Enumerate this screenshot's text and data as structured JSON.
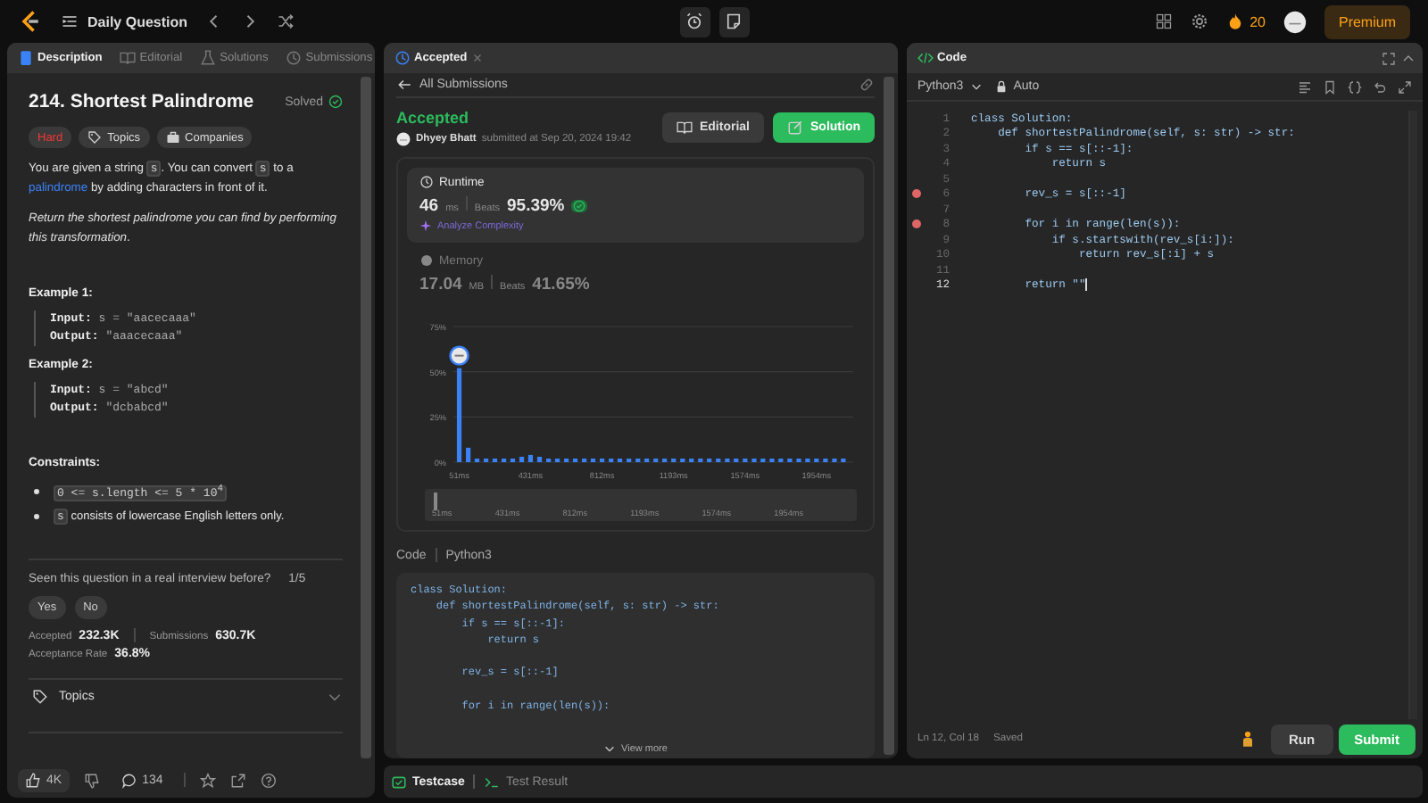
{
  "topbar": {
    "title": "Daily Question",
    "streak": "20",
    "premium": "Premium"
  },
  "description_panel": {
    "tabs": [
      {
        "label": "Description",
        "selected": true
      },
      {
        "label": "Editorial",
        "selected": false
      },
      {
        "label": "Solutions",
        "selected": false
      },
      {
        "label": "Submissions",
        "selected": false
      }
    ],
    "title": "214. Shortest Palindrome",
    "status": "Solved",
    "difficulty": "Hard",
    "tags": [
      "Topics",
      "Companies"
    ],
    "paragraphs": [
      [
        {
          "kind": "text",
          "text": "You are given a string "
        },
        {
          "kind": "code",
          "text": "s"
        },
        {
          "kind": "text",
          "text": ". You can convert "
        },
        {
          "kind": "code",
          "text": "s"
        },
        {
          "kind": "text",
          "text": " to a "
        },
        {
          "kind": "link",
          "text": "palindrome"
        },
        {
          "kind": "text",
          "text": " by adding characters in front of it."
        }
      ],
      [
        {
          "kind": "italic",
          "text": "Return "
        },
        {
          "kind": "text",
          "text": "*the shortest palindrome you can find by performing this transformation*."
        }
      ]
    ],
    "examples": [
      {
        "title": "Example 1:",
        "lines": [
          "**Input:** s = \"aacecaaa\"",
          "**Output:** \"aaacecaaa\""
        ]
      },
      {
        "title": "Example 2:",
        "lines": [
          "**Input:** s = \"abcd\"",
          "**Output:** \"dcbabcd\""
        ]
      }
    ],
    "constraints_title": "Constraints:",
    "constraints": [
      [
        {
          "kind": "code",
          "text": "0 <= s.length <= 5 * 10$^{4}$"
        }
      ],
      [
        {
          "kind": "code",
          "text": "s"
        },
        {
          "kind": "text",
          "text": " consists of lowercase English letters only."
        }
      ]
    ],
    "interview": {
      "question": "Seen this question in a real interview before?",
      "count": "1/5",
      "answers": [
        "Yes",
        "No"
      ]
    },
    "stats": [
      {
        "label": "Accepted",
        "value": "232.3K"
      },
      {
        "label": "Submissions",
        "value": "630.7K"
      },
      {
        "label": "Acceptance Rate",
        "value": "36.8%"
      }
    ],
    "topics": "Topics",
    "likes": "4K",
    "comments": "134"
  },
  "submission_panel": {
    "tab": "Accepted",
    "back": "All Submissions",
    "verdict": "Accepted",
    "user": "Dhyey Bhatt",
    "submitted": "submitted at Sep 20, 2024 19:42",
    "buttons": [
      "Editorial",
      "Solution"
    ],
    "metrics": [
      {
        "kind": "runtime",
        "label": "Runtime",
        "value": "46",
        "unit": "ms",
        "beats_label": "Beats",
        "beats": "95.39%",
        "link": "Analyze Complexity",
        "selected": true
      },
      {
        "kind": "memory",
        "label": "Memory",
        "value": "17.04",
        "unit": "MB",
        "beats_label": "Beats",
        "beats": "41.65%",
        "selected": false
      }
    ],
    "chart_data": {
      "type": "bar",
      "x": [
        51,
        99,
        146,
        194,
        241,
        289,
        336,
        384,
        431,
        479,
        527,
        574,
        622,
        669,
        717,
        764,
        812,
        860,
        907,
        955,
        1003,
        1050,
        1098,
        1145,
        1193,
        1241,
        1288,
        1336,
        1383,
        1431,
        1479,
        1526,
        1574,
        1622,
        1669,
        1717,
        1764,
        1812,
        1860,
        1907,
        1954,
        2002,
        2050,
        2097
      ],
      "series": [
        {
          "color": "#3b82f6",
          "values": [
            52,
            8,
            2,
            2,
            2,
            2,
            2,
            3,
            4,
            3,
            2,
            2,
            2,
            2,
            2,
            2,
            2,
            2,
            2,
            2,
            2,
            2,
            2,
            2,
            2,
            2,
            2,
            2,
            2,
            2,
            2,
            2,
            2,
            2,
            2,
            2,
            2,
            2,
            2,
            2,
            2,
            2,
            2,
            2
          ]
        }
      ],
      "xlim": [
        20,
        2150
      ],
      "ylim": [
        0,
        75
      ],
      "xticks": [
        {
          "value": 51,
          "label": "51ms"
        },
        {
          "value": 431,
          "label": "431ms"
        },
        {
          "value": 812,
          "label": "812ms"
        },
        {
          "value": 1193,
          "label": "1193ms"
        },
        {
          "value": 1574,
          "label": "1574ms"
        },
        {
          "value": 1954,
          "label": "1954ms"
        }
      ],
      "yticks": [
        {
          "value": 0,
          "label": "0%"
        },
        {
          "value": 25,
          "label": "25%"
        },
        {
          "value": 50,
          "label": "50%"
        },
        {
          "value": 75,
          "label": "75%"
        }
      ]
    },
    "overview_range": {
      "level": 0.02
    },
    "overview_labels": [
      "51ms",
      "431ms",
      "812ms",
      "1193ms",
      "1574ms",
      "1954ms"
    ],
    "code_label": "Code",
    "code_language": "Python3",
    "code": [
      {
        "kind": "code",
        "text": "class Solution:"
      },
      {
        "kind": "code",
        "text": "    def shortestPalindrome(self, s: str) -> str:"
      },
      {
        "kind": "code",
        "text": "        if s == s[::-1]:"
      },
      {
        "kind": "code",
        "text": "            return s"
      },
      {
        "kind": "blank"
      },
      {
        "kind": "code",
        "text": "        rev_s = s[::-1]"
      },
      {
        "kind": "blank"
      },
      {
        "kind": "code",
        "text": "        for i in range(len(s)):"
      }
    ],
    "view_more": "View more"
  },
  "bottom_tabs": [
    {
      "label": "Testcase",
      "selected": true
    },
    {
      "label": "Test Result",
      "selected": false
    }
  ],
  "editor": {
    "title": "Code",
    "language": "Python3",
    "mode": "Auto",
    "lines": [
      {
        "number": "1",
        "kind": "code",
        "text": "class Solution:",
        "breakpoint": false,
        "current": false
      },
      {
        "number": "2",
        "kind": "code",
        "text": "    def shortestPalindrome(self, s: str) -> str:",
        "breakpoint": false,
        "current": false
      },
      {
        "number": "3",
        "kind": "code",
        "text": "        if s == s[::-1]:",
        "breakpoint": false,
        "current": false
      },
      {
        "number": "4",
        "kind": "code",
        "text": "            return s",
        "breakpoint": false,
        "current": false
      },
      {
        "number": "5",
        "kind": "blank",
        "breakpoint": false,
        "current": false
      },
      {
        "number": "6",
        "kind": "code",
        "text": "        rev_s = s[::-1]",
        "breakpoint": true,
        "current": false
      },
      {
        "number": "7",
        "kind": "blank",
        "breakpoint": false,
        "current": false
      },
      {
        "number": "8",
        "kind": "code",
        "text": "        for i in range(len(s)):",
        "breakpoint": true,
        "current": false
      },
      {
        "number": "9",
        "kind": "code",
        "text": "            if s.startswith(rev_s[i:]):",
        "breakpoint": false,
        "current": false
      },
      {
        "number": "10",
        "kind": "code",
        "text": "                return rev_s[:i] + s",
        "breakpoint": false,
        "current": false
      },
      {
        "number": "11",
        "kind": "blank",
        "breakpoint": false,
        "current": false
      },
      {
        "number": "12",
        "kind": "code",
        "text": "        return \"\"",
        "breakpoint": false,
        "current": true
      }
    ],
    "position": "Ln 12, Col 18",
    "saved": "Saved",
    "run": "Run",
    "submit": "Submit"
  }
}
